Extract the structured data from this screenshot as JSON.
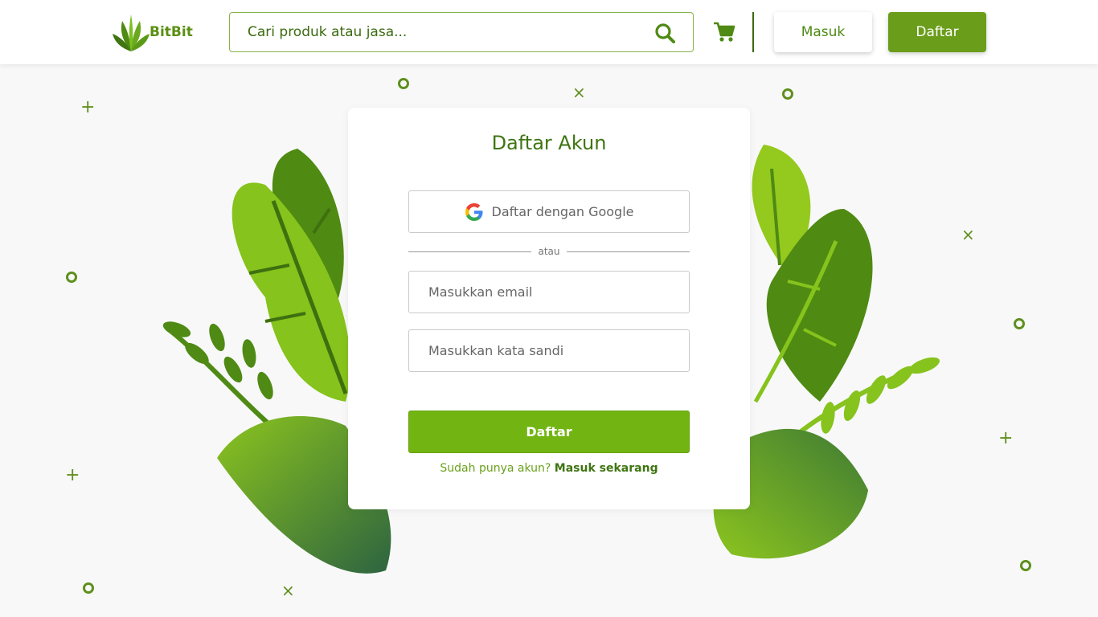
{
  "brand": {
    "name": "BitBit"
  },
  "header": {
    "search_placeholder": "Cari produk atau jasa...",
    "login_label": "Masuk",
    "register_label": "Daftar"
  },
  "form": {
    "title": "Daftar Akun",
    "google_label": "Daftar dengan Google",
    "or_text": "atau",
    "email_placeholder": "Masukkan email",
    "password_placeholder": "Masukkan kata sandi",
    "submit_label": "Daftar",
    "have_account_text": "Sudah punya akun?",
    "login_now_label": "Masuk sekarang"
  },
  "colors": {
    "primary": "#6a9d1a",
    "submit": "#72b512",
    "dark_green": "#3f7512",
    "background": "#f8f8f8"
  },
  "icons": {
    "search": "search-icon",
    "cart": "cart-icon",
    "google": "google-icon"
  }
}
